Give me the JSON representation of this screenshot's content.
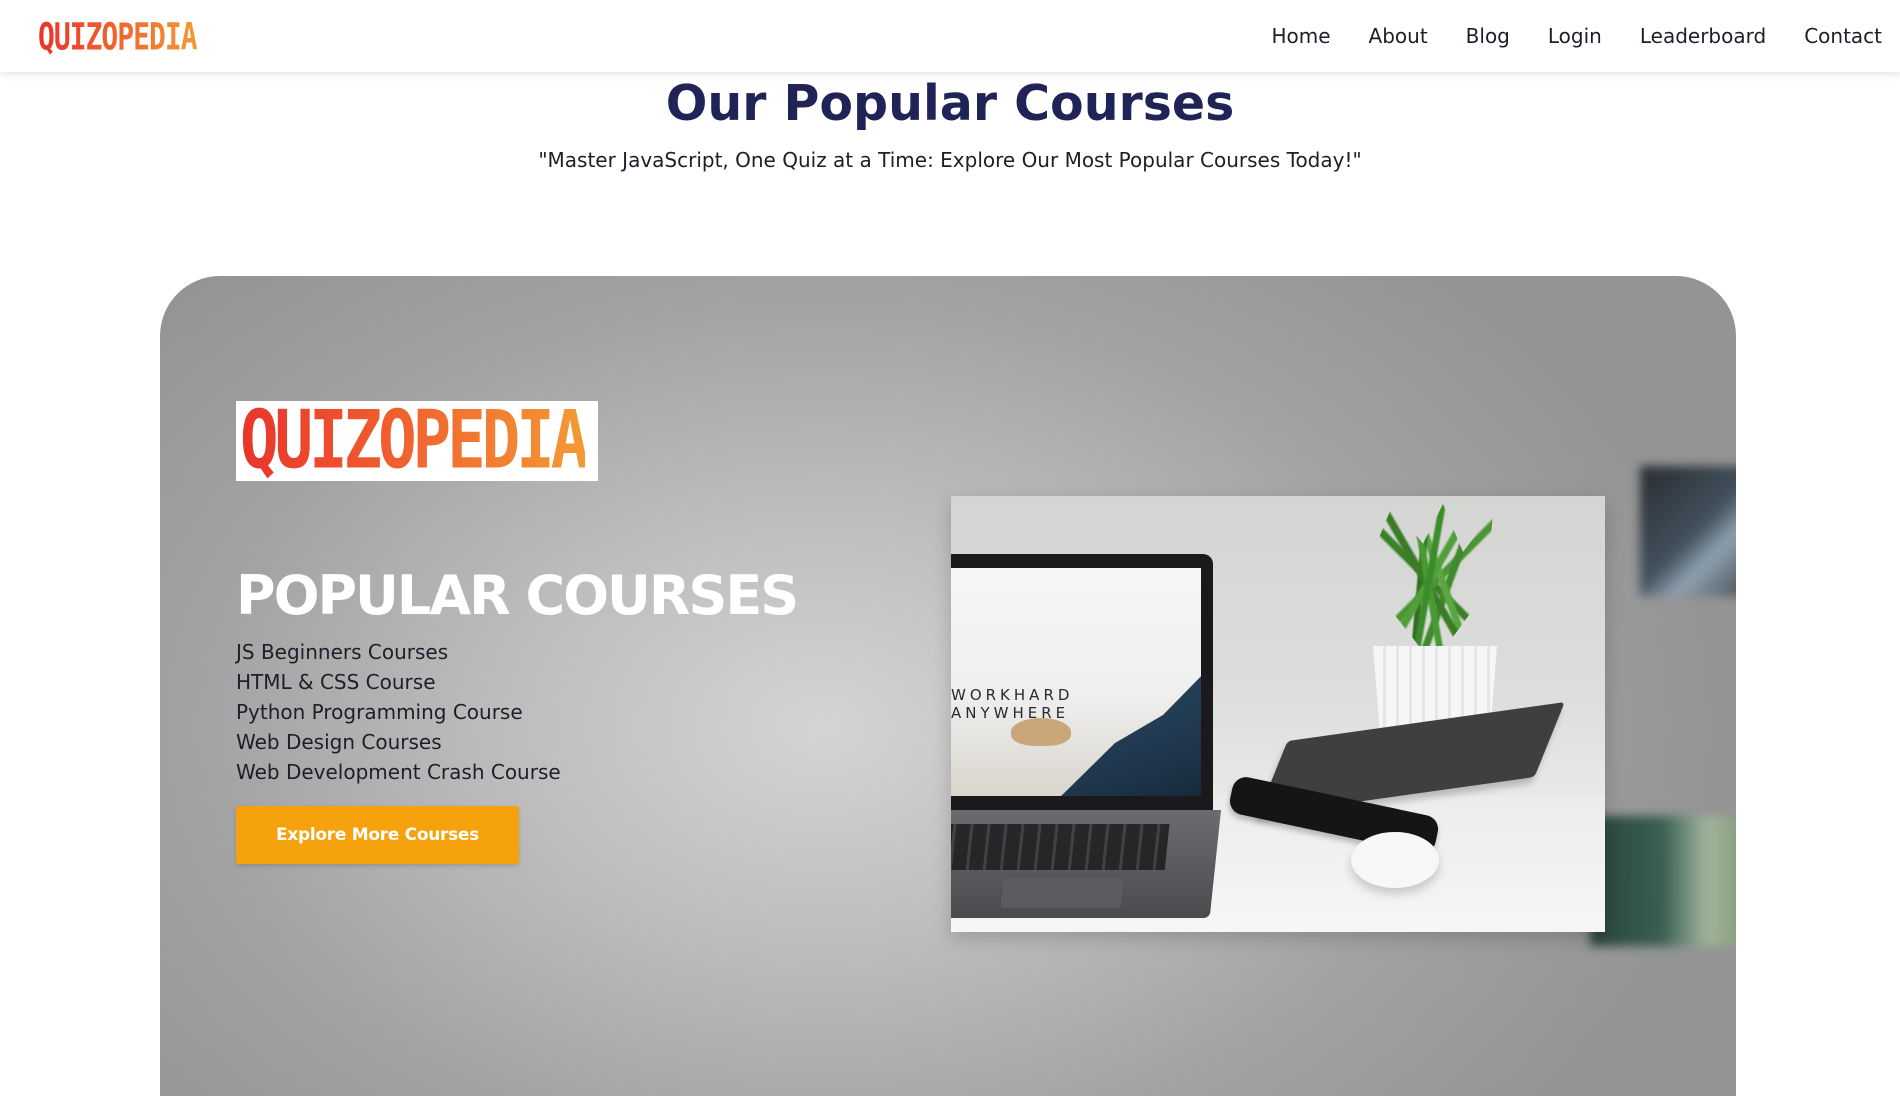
{
  "brand": {
    "logo_text": "QUIZOPEDIA"
  },
  "nav": {
    "items": [
      {
        "label": "Home"
      },
      {
        "label": "About"
      },
      {
        "label": "Blog"
      },
      {
        "label": "Login"
      },
      {
        "label": "Leaderboard"
      },
      {
        "label": "Contact"
      }
    ]
  },
  "section": {
    "title": "Our Popular Courses",
    "subtitle": "\"Master JavaScript, One Quiz at a Time: Explore Our Most Popular Courses Today!\""
  },
  "hero": {
    "logo_text": "QUIZOPEDIA",
    "heading": "POPULAR COURSES",
    "courses": [
      "JS Beginners Courses",
      "HTML & CSS Course",
      "Python Programming Course",
      "Web Design Courses",
      "Web Development Crash Course"
    ],
    "cta_label": "Explore More Courses",
    "photo": {
      "screen_text_line1": "WORKHARD",
      "screen_text_line2": "ANYWHERE"
    }
  },
  "colors": {
    "title": "#1f2356",
    "cta": "#f5a20d",
    "logo_gradient_start": "#e8342c",
    "logo_gradient_end": "#f39a34"
  },
  "icons": {
    "brand": "quizopedia-logo"
  }
}
